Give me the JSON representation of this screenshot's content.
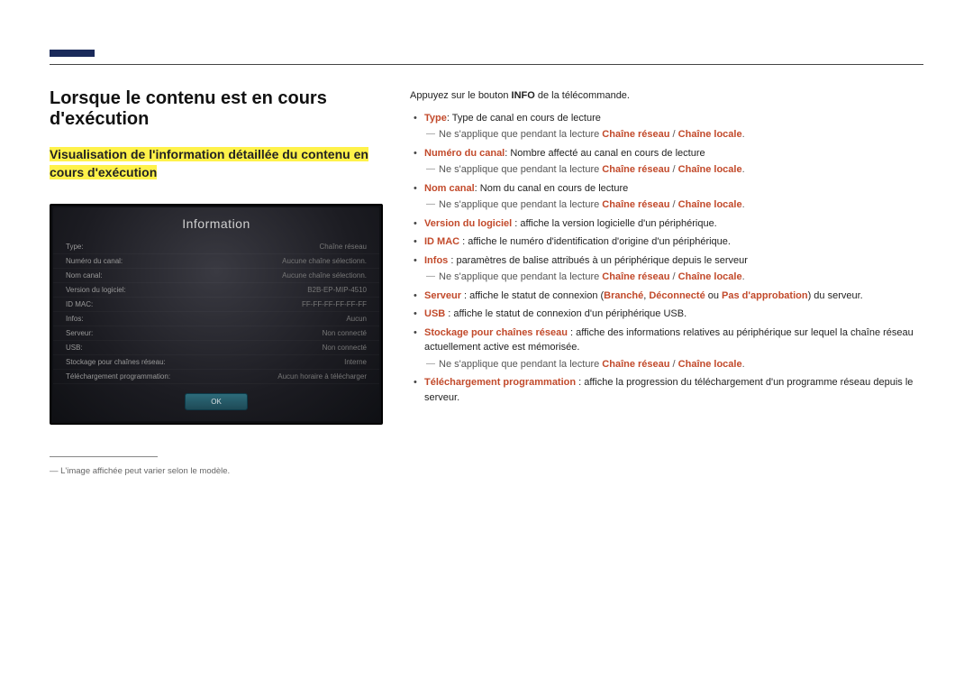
{
  "heading": "Lorsque le contenu est en cours d'exécution",
  "subheading": "Visualisation de l'information détaillée du contenu en cours d'exécution",
  "panel": {
    "title": "Information",
    "rows": [
      {
        "label": "Type:",
        "value": "Chaîne réseau"
      },
      {
        "label": "Numéro du canal:",
        "value": "Aucune chaîne sélectionn."
      },
      {
        "label": "Nom canal:",
        "value": "Aucune chaîne sélectionn."
      },
      {
        "label": "Version du logiciel:",
        "value": "B2B-EP-MIP-4510"
      },
      {
        "label": "ID MAC:",
        "value": "FF-FF-FF-FF-FF-FF"
      },
      {
        "label": "Infos:",
        "value": "Aucun"
      },
      {
        "label": "Serveur:",
        "value": "Non connecté"
      },
      {
        "label": "USB:",
        "value": "Non connecté"
      },
      {
        "label": "Stockage pour chaînes réseau:",
        "value": "Interne"
      },
      {
        "label": "Téléchargement programmation:",
        "value": "Aucun horaire à télécharger"
      }
    ],
    "ok": "OK"
  },
  "footnote": "L'image affichée peut varier selon le modèle.",
  "intro_pre": "Appuyez sur le bouton ",
  "intro_bold": "INFO",
  "intro_post": " de la télécommande.",
  "items": {
    "type_label": "Type",
    "type_desc": ": Type de canal en cours de lecture",
    "applies_pre": "Ne s'applique que pendant la lecture ",
    "applies_net": "Chaîne réseau",
    "applies_sep": " / ",
    "applies_loc": "Chaîne locale",
    "applies_dot": ".",
    "numcanal_label": "Numéro du canal",
    "numcanal_desc": ": Nombre affecté au canal en cours de lecture",
    "nomcanal_label": "Nom canal",
    "nomcanal_desc": ": Nom du canal en cours de lecture",
    "ver_label": "Version du logiciel",
    "ver_desc": " : affiche la version logicielle d'un périphérique.",
    "mac_label": "ID MAC",
    "mac_desc": " : affiche le numéro d'identification d'origine d'un périphérique.",
    "infos_label": "Infos",
    "infos_desc": " : paramètres de balise attribués à un périphérique depuis le serveur",
    "srv_label": "Serveur",
    "srv_pre": " : affiche le statut de connexion (",
    "srv_b1": "Branché",
    "srv_c1": ", ",
    "srv_b2": "Déconnecté",
    "srv_c2": " ou ",
    "srv_b3": "Pas d'approbation",
    "srv_post": ") du serveur.",
    "usb_label": "USB",
    "usb_desc": " : affiche le statut de connexion d'un périphérique USB.",
    "stor_label": "Stockage pour chaînes réseau",
    "stor_desc": " : affiche des informations relatives au périphérique sur lequel la chaîne réseau actuellement active est mémorisée.",
    "dl_label": "Téléchargement programmation",
    "dl_desc": " : affiche la progression du téléchargement d'un programme réseau depuis le serveur."
  }
}
